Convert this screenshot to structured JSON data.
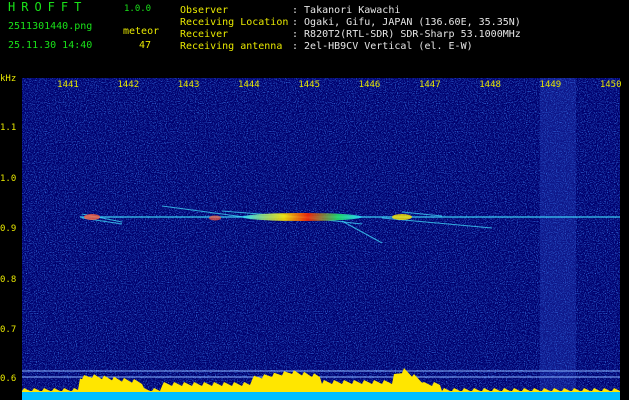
{
  "app": {
    "name": "HROFFT",
    "version": "1.0.0"
  },
  "file": {
    "name": "2511301440.png",
    "datetime": "25.11.30 14:40"
  },
  "meteor": {
    "label": "meteor",
    "count": "47"
  },
  "info": [
    {
      "label": "Observer",
      "value": ": Takanori Kawachi"
    },
    {
      "label": "Receiving Location",
      "value": ": Ogaki, Gifu, JAPAN (136.60E, 35.35N)"
    },
    {
      "label": "Receiver",
      "value": ": R820T2(RTL-SDR) SDR-Sharp 53.1000MHz"
    },
    {
      "label": "Receiving antenna",
      "value": ": 2el-HB9CV Vertical (el. E-W)"
    }
  ],
  "y_axis": {
    "unit": "kHz",
    "ticks": [
      "1.1",
      "1.0",
      "0.9",
      "0.8",
      "0.7",
      "0.6"
    ]
  },
  "x_axis": {
    "ticks": [
      "1441",
      "1442",
      "1443",
      "1444",
      "1445",
      "1446",
      "1447",
      "1448",
      "1449",
      "1450"
    ]
  },
  "colors": {
    "background": "#00006e",
    "header_text": "#19e219",
    "axis_text": "#e8e800",
    "info_text": "#e6e6e6",
    "carrier": "#40e0ff",
    "noise_floor": "#00bfff",
    "signal_peak": "#ffe600"
  }
}
